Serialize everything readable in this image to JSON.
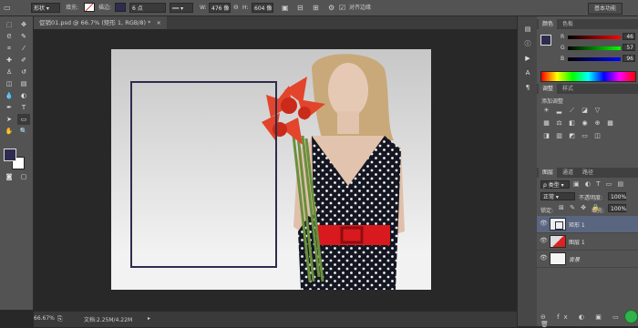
{
  "options_bar": {
    "shape_mode": "形状",
    "fill_label": "填充:",
    "stroke_label": "描边:",
    "stroke_width": "6 点",
    "w_label": "W:",
    "w_value": "476 像",
    "link_icon": "link-icon",
    "h_label": "H:",
    "h_value": "604 像",
    "align_edges_label": "对齐边缘",
    "align_edges_checked": true,
    "workspace": "基本功能",
    "stroke_color": "#2e2c4e"
  },
  "document_tab": {
    "title": "促销01.psd @ 66.7% (矩形 1, RGB/8) *",
    "close": "×"
  },
  "canvas": {
    "image_alt": "woman holding red flowers"
  },
  "status_bar": {
    "zoom": "66.67%",
    "doc_info": "文档:2.25M/4.22M"
  },
  "tool_colors": {
    "foreground": "#2e2c4e",
    "background": "#ffffff"
  },
  "color_panel": {
    "tabs": [
      "颜色",
      "色板"
    ],
    "channels": [
      {
        "label": "R",
        "value": "46"
      },
      {
        "label": "G",
        "value": "57"
      },
      {
        "label": "B",
        "value": "96"
      }
    ]
  },
  "adjustments_panel": {
    "tabs": [
      "调整",
      "样式"
    ],
    "add_adjustment": "添加调整"
  },
  "layers_panel": {
    "tabs": [
      "图层",
      "通道",
      "路径"
    ],
    "kind_label": "类型",
    "blend_mode": "正常",
    "opacity_label": "不透明度:",
    "opacity_value": "100%",
    "lock_label": "锁定:",
    "fill_label": "填充:",
    "fill_value": "100%",
    "layers": [
      {
        "name": "矩形 1",
        "selected": true
      },
      {
        "name": "图层 1",
        "selected": false
      },
      {
        "name": "背景",
        "selected": false
      }
    ]
  }
}
